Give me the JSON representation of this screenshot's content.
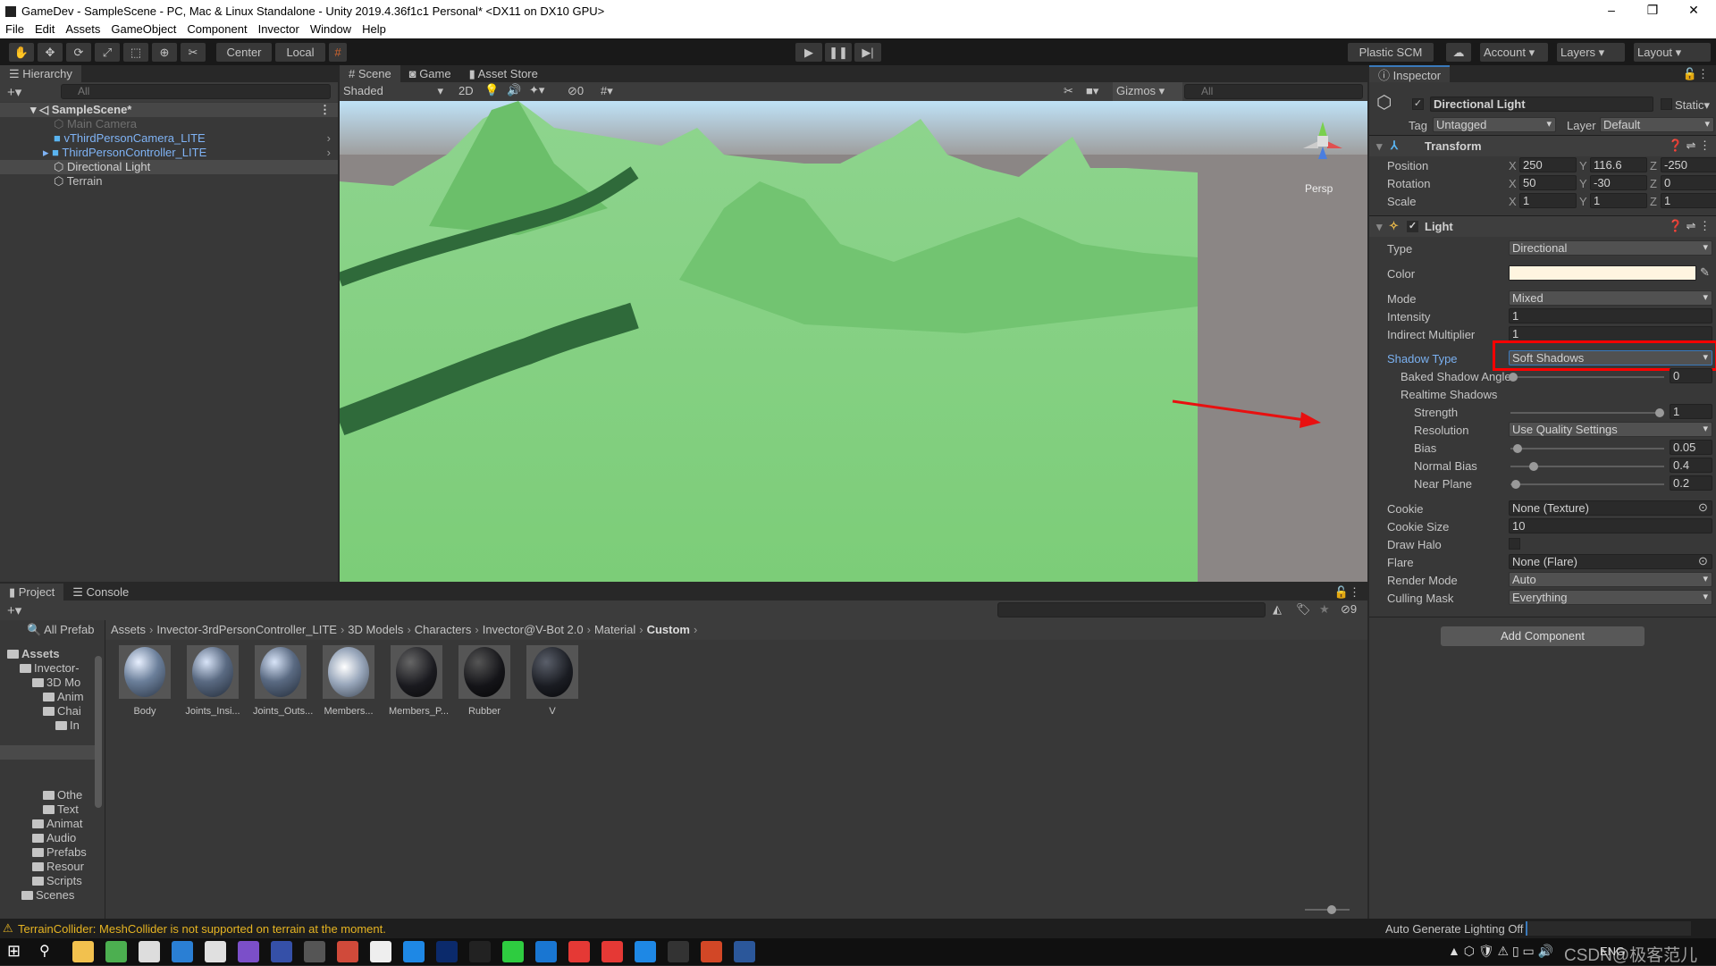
{
  "window": {
    "title": "GameDev - SampleScene - PC, Mac & Linux Standalone - Unity 2019.4.36f1c1 Personal* <DX11 on DX10 GPU>",
    "minimize": "–",
    "maximize": "❐",
    "close": "✕"
  },
  "menu": [
    "File",
    "Edit",
    "Assets",
    "GameObject",
    "Component",
    "Invector",
    "Window",
    "Help"
  ],
  "toolbar": {
    "pivot": "Center",
    "space": "Local",
    "plastic": "Plastic SCM",
    "account": "Account",
    "layers": "Layers",
    "layout": "Layout"
  },
  "hierarchy": {
    "tab": "Hierarchy",
    "search_placeholder": "All",
    "scene": "SampleScene*",
    "items": [
      {
        "label": "Main Camera",
        "state": "disabled"
      },
      {
        "label": "vThirdPersonCamera_LITE",
        "state": "prefab"
      },
      {
        "label": "ThirdPersonController_LITE",
        "state": "prefab"
      },
      {
        "label": "Directional Light",
        "state": "selected"
      },
      {
        "label": "Terrain",
        "state": "normal"
      }
    ]
  },
  "scene": {
    "tabs": [
      "Scene",
      "Game",
      "Asset Store"
    ],
    "active_tab": "Scene",
    "shading": "Shaded",
    "mode2d": "2D",
    "hidden_count": "0",
    "gizmos": "Gizmos",
    "search_placeholder": "All",
    "projection": "Persp"
  },
  "inspector": {
    "tab": "Inspector",
    "object_name": "Directional Light",
    "static": "Static",
    "tag_label": "Tag",
    "tag": "Untagged",
    "layer_label": "Layer",
    "layer": "Default",
    "transform": {
      "title": "Transform",
      "rows": [
        {
          "label": "Position",
          "x": "250",
          "y": "116.6",
          "z": "-250"
        },
        {
          "label": "Rotation",
          "x": "50",
          "y": "-30",
          "z": "0"
        },
        {
          "label": "Scale",
          "x": "1",
          "y": "1",
          "z": "1"
        }
      ]
    },
    "light": {
      "title": "Light",
      "type_label": "Type",
      "type": "Directional",
      "color_label": "Color",
      "color": "#fff5e0",
      "mode_label": "Mode",
      "mode": "Mixed",
      "intensity_label": "Intensity",
      "intensity": "1",
      "indirect_label": "Indirect Multiplier",
      "indirect": "1",
      "shadow_type_label": "Shadow Type",
      "shadow_type": "Soft Shadows",
      "baked_angle_label": "Baked Shadow Angle",
      "baked_angle": "0",
      "realtime_label": "Realtime Shadows",
      "strength_label": "Strength",
      "strength": "1",
      "resolution_label": "Resolution",
      "resolution": "Use Quality Settings",
      "bias_label": "Bias",
      "bias": "0.05",
      "normal_bias_label": "Normal Bias",
      "normal_bias": "0.4",
      "near_plane_label": "Near Plane",
      "near_plane": "0.2",
      "cookie_label": "Cookie",
      "cookie": "None (Texture)",
      "cookie_size_label": "Cookie Size",
      "cookie_size": "10",
      "draw_halo_label": "Draw Halo",
      "flare_label": "Flare",
      "flare": "None (Flare)",
      "render_mode_label": "Render Mode",
      "render_mode": "Auto",
      "culling_label": "Culling Mask",
      "culling": "Everything"
    },
    "add_component": "Add Component",
    "highlight_color": "#ff0000"
  },
  "project": {
    "tabs": [
      "Project",
      "Console"
    ],
    "filter": "All Prefab",
    "breadcrumb": [
      "Assets",
      "Invector-3rdPersonController_LITE",
      "3D Models",
      "Characters",
      "Invector@V-Bot 2.0",
      "Material",
      "Custom"
    ],
    "hidden_count": "9",
    "tree": [
      "Assets",
      "Invector-",
      "3D Mo",
      "Anim",
      "Chai",
      "In",
      "Othe",
      "Text",
      "Animat",
      "Audio",
      "Prefabs",
      "Resour",
      "Scripts",
      "Scenes"
    ],
    "assets": [
      {
        "name": "Body"
      },
      {
        "name": "Joints_Insi..."
      },
      {
        "name": "Joints_Outs..."
      },
      {
        "name": "Members..."
      },
      {
        "name": "Members_P..."
      },
      {
        "name": "Rubber"
      },
      {
        "name": "V"
      }
    ]
  },
  "status": {
    "message": "TerrainCollider: MeshCollider is not supported on terrain at the moment.",
    "lighting": "Auto Generate Lighting Off",
    "warning_color": "#e6b422"
  },
  "taskbar": {
    "tray_lang": "ENG",
    "watermark": "CSDN@极客范儿"
  }
}
